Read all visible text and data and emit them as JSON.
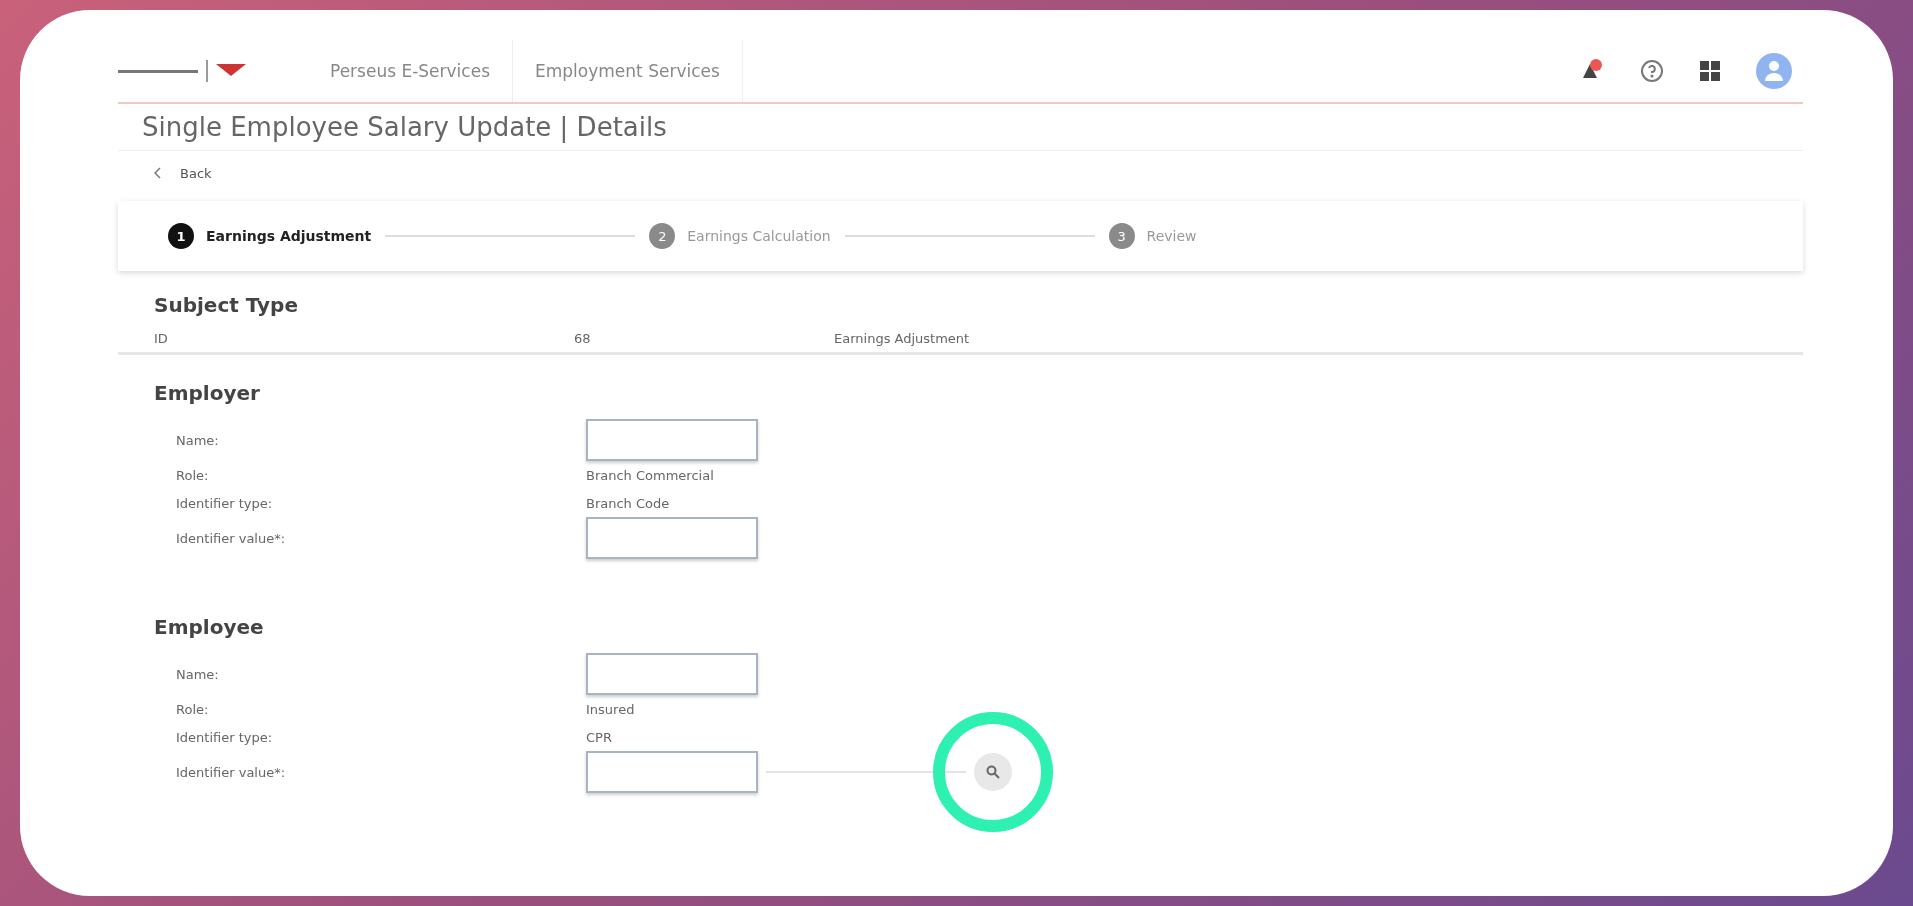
{
  "nav": [
    "Perseus E-Services",
    "Employment Services"
  ],
  "notification_badge": true,
  "page_title": "Single Employee Salary Update | Details",
  "back": "Back",
  "steps": [
    {
      "number": "1",
      "label": "Earnings Adjustment",
      "selected": true
    },
    {
      "number": "2",
      "label": "Earnings Calculation",
      "selected": false
    },
    {
      "number": "3",
      "label": "Review",
      "selected": false
    }
  ],
  "subject_type": {
    "heading": "Subject Type",
    "cells": [
      "ID",
      "68",
      "Earnings Adjustment"
    ]
  },
  "sections": [
    {
      "heading": "Employer",
      "fields": [
        {
          "label": "Name:",
          "kind": "input"
        },
        {
          "label": "Role:",
          "kind": "text",
          "value": "Branch Commercial"
        },
        {
          "label": "Identifier type:",
          "kind": "text",
          "value": "Branch Code"
        },
        {
          "label": "Identifier value*:",
          "kind": "input"
        }
      ]
    },
    {
      "heading": "Employee",
      "fields": [
        {
          "label": "Name:",
          "kind": "input"
        },
        {
          "label": "Role:",
          "kind": "text",
          "value": "Insured"
        },
        {
          "label": "Identifier type:",
          "kind": "text",
          "value": "CPR"
        },
        {
          "label": "Identifier value*:",
          "kind": "search"
        }
      ]
    }
  ]
}
